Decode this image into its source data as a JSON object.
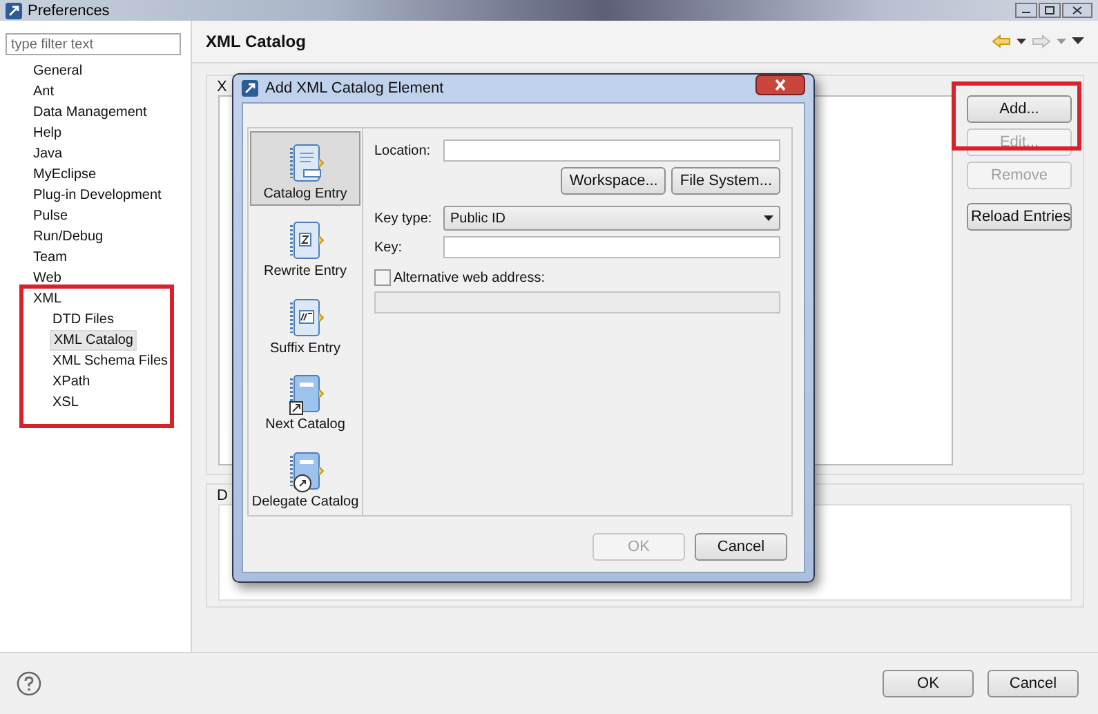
{
  "window": {
    "title": "Preferences"
  },
  "sidebar": {
    "filter": {
      "placeholder": "type filter text"
    },
    "items": [
      {
        "label": "General",
        "selected": false
      },
      {
        "label": "Ant",
        "selected": false
      },
      {
        "label": "Data Management",
        "selected": false
      },
      {
        "label": "Help",
        "selected": false
      },
      {
        "label": "Java",
        "selected": false
      },
      {
        "label": "MyEclipse",
        "selected": false
      },
      {
        "label": "Plug-in Development",
        "selected": false
      },
      {
        "label": "Pulse",
        "selected": false
      },
      {
        "label": "Run/Debug",
        "selected": false
      },
      {
        "label": "Team",
        "selected": false
      },
      {
        "label": "Web",
        "selected": false
      },
      {
        "label": "XML",
        "selected": false,
        "children": [
          {
            "label": "DTD Files",
            "selected": false
          },
          {
            "label": "XML Catalog",
            "selected": true
          },
          {
            "label": "XML Schema Files",
            "selected": false
          },
          {
            "label": "XPath",
            "selected": false
          },
          {
            "label": "XSL",
            "selected": false
          }
        ]
      }
    ]
  },
  "page": {
    "title": "XML Catalog",
    "section_label": "X",
    "details_label": "D",
    "buttons": [
      {
        "label": "Add...",
        "disabled": false
      },
      {
        "label": "Edit...",
        "disabled": true
      },
      {
        "label": "Remove",
        "disabled": true
      },
      {
        "label": "Reload Entries",
        "disabled": false
      }
    ]
  },
  "dialog": {
    "title": "Add XML Catalog Element",
    "entry_types": [
      {
        "label": "Catalog Entry",
        "kind": "entry",
        "selected": true
      },
      {
        "label": "Rewrite Entry",
        "kind": "rewrite",
        "selected": false
      },
      {
        "label": "Suffix Entry",
        "kind": "suffix",
        "selected": false
      },
      {
        "label": "Next Catalog",
        "kind": "next",
        "selected": false
      },
      {
        "label": "Delegate Catalog",
        "kind": "delegate",
        "selected": false
      }
    ],
    "location_label": "Location:",
    "workspace_button": "Workspace...",
    "file_system_button": "File System...",
    "key_type_label": "Key type:",
    "key_type_value": "Public ID",
    "key_label": "Key:",
    "alt_web": {
      "label": "Alternative web address:",
      "checked": false
    },
    "buttons": [
      {
        "label": "OK",
        "disabled": true
      },
      {
        "label": "Cancel",
        "disabled": false
      }
    ]
  },
  "footer_buttons": [
    {
      "label": "OK"
    },
    {
      "label": "Cancel"
    }
  ]
}
